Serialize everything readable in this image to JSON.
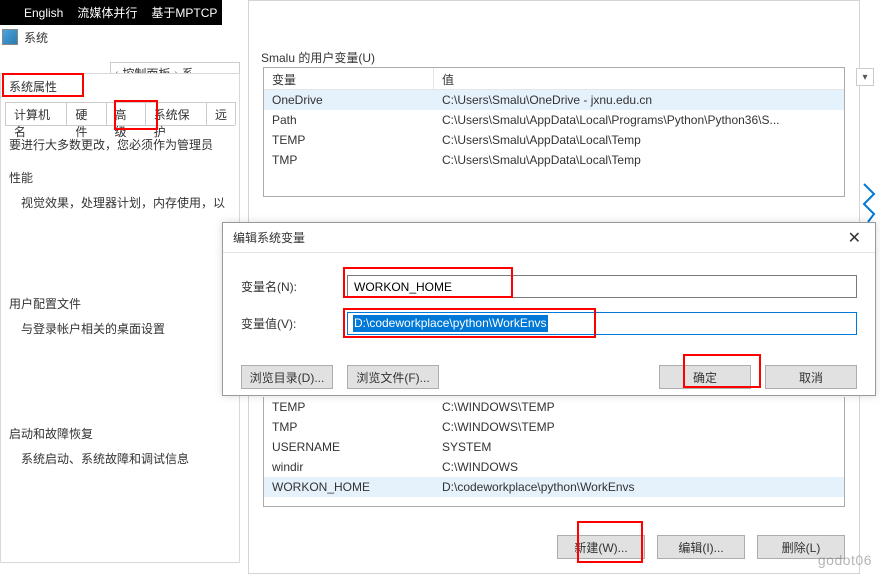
{
  "blackbar": {
    "items": [
      "English",
      "流媒体并行",
      "基于MPTCP"
    ]
  },
  "sys_window_title": "系统",
  "breadcrumb": {
    "left": "控制面板",
    "right": "系"
  },
  "sysprop": {
    "title": "系统属性",
    "tabs": [
      "计算机名",
      "硬件",
      "高级",
      "系统保护",
      "远"
    ],
    "active_tab": 2,
    "note": "要进行大多数更改，您必须作为管理员",
    "groups": [
      {
        "title": "性能",
        "text": "视觉效果，处理器计划，内存使用，以"
      },
      {
        "title": "用户配置文件",
        "text": "与登录帐户相关的桌面设置"
      },
      {
        "title": "启动和故障恢复",
        "text": "系统启动、系统故障和调试信息"
      }
    ]
  },
  "envdlg": {
    "section_label": "Smalu 的用户变量(U)",
    "headers": {
      "col1": "变量",
      "col2": "值"
    },
    "user_vars": [
      {
        "name": "OneDrive",
        "value": "C:\\Users\\Smalu\\OneDrive - jxnu.edu.cn",
        "selected": true
      },
      {
        "name": "Path",
        "value": "C:\\Users\\Smalu\\AppData\\Local\\Programs\\Python\\Python36\\S..."
      },
      {
        "name": "TEMP",
        "value": "C:\\Users\\Smalu\\AppData\\Local\\Temp"
      },
      {
        "name": "TMP",
        "value": "C:\\Users\\Smalu\\AppData\\Local\\Temp"
      }
    ],
    "sys_vars_visible": [
      {
        "name": "TEMP",
        "value": "C:\\WINDOWS\\TEMP"
      },
      {
        "name": "TMP",
        "value": "C:\\WINDOWS\\TEMP"
      },
      {
        "name": "USERNAME",
        "value": "SYSTEM"
      },
      {
        "name": "windir",
        "value": "C:\\WINDOWS"
      },
      {
        "name": "WORKON_HOME",
        "value": "D:\\codeworkplace\\python\\WorkEnvs",
        "selected": true
      }
    ],
    "buttons": {
      "new": "新建(W)...",
      "edit": "编辑(I)...",
      "delete": "删除(L)"
    }
  },
  "editdlg": {
    "title": "编辑系统变量",
    "name_label": "变量名(N):",
    "value_label": "变量值(V):",
    "name_value": "WORKON_HOME",
    "value_value": "D:\\codeworkplace\\python\\WorkEnvs",
    "browse_dir": "浏览目录(D)...",
    "browse_file": "浏览文件(F)...",
    "ok": "确定",
    "cancel": "取消"
  },
  "watermark": "godot06"
}
